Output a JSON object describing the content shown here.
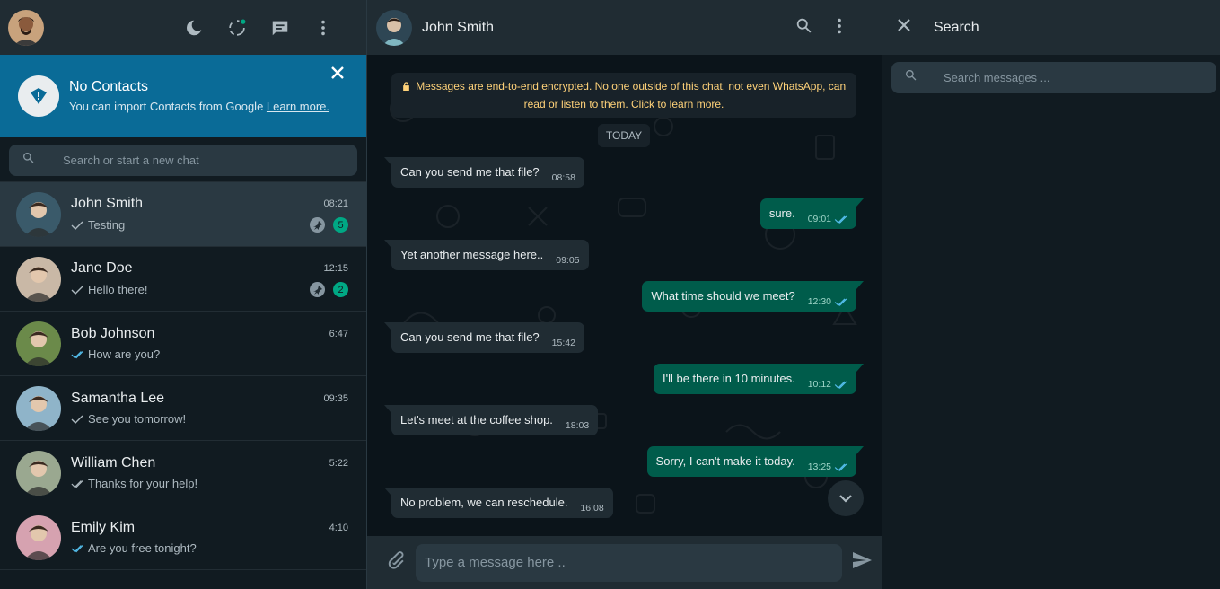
{
  "left": {
    "banner": {
      "title": "No Contacts",
      "subtitle": "You can import Contacts from Google",
      "link": "Learn more."
    },
    "search_placeholder": "Search or start a new chat",
    "chats": [
      {
        "name": "John Smith",
        "time": "08:21",
        "last": "Testing",
        "tick": "single",
        "pinned": true,
        "unread": "5",
        "active": true,
        "avatar_color": "#3a5a6a"
      },
      {
        "name": "Jane Doe",
        "time": "12:15",
        "last": "Hello there!",
        "tick": "single",
        "pinned": true,
        "unread": "2",
        "active": false,
        "avatar_color": "#c9b8a6"
      },
      {
        "name": "Bob Johnson",
        "time": "6:47",
        "last": "How are you?",
        "tick": "double-read",
        "pinned": false,
        "unread": "",
        "active": false,
        "avatar_color": "#6b8a4a"
      },
      {
        "name": "Samantha Lee",
        "time": "09:35",
        "last": "See you tomorrow!",
        "tick": "single",
        "pinned": false,
        "unread": "",
        "active": false,
        "avatar_color": "#8fb4c9"
      },
      {
        "name": "William Chen",
        "time": "5:22",
        "last": "Thanks for your help!",
        "tick": "double",
        "pinned": false,
        "unread": "",
        "active": false,
        "avatar_color": "#9aa890"
      },
      {
        "name": "Emily Kim",
        "time": "4:10",
        "last": "Are you free tonight?",
        "tick": "double-read",
        "pinned": false,
        "unread": "",
        "active": false,
        "avatar_color": "#d6a2b0"
      }
    ]
  },
  "chat": {
    "contact_name": "John Smith",
    "encryption_notice": "Messages are end-to-end encrypted. No one outside of this chat, not even WhatsApp, can read or listen to them. Click to learn more.",
    "day_label": "TODAY",
    "messages": [
      {
        "dir": "in",
        "text": "Can you send me that file?",
        "time": "08:58"
      },
      {
        "dir": "out",
        "text": "sure.",
        "time": "09:01"
      },
      {
        "dir": "in",
        "text": "Yet another message here..",
        "time": "09:05"
      },
      {
        "dir": "out",
        "text": "What time should we meet?",
        "time": "12:30"
      },
      {
        "dir": "in",
        "text": "Can you send me that file?",
        "time": "15:42"
      },
      {
        "dir": "out",
        "text": "I'll be there in 10 minutes.",
        "time": "10:12"
      },
      {
        "dir": "in",
        "text": "Let's meet at the coffee shop.",
        "time": "18:03"
      },
      {
        "dir": "out",
        "text": "Sorry, I can't make it today.",
        "time": "13:25"
      },
      {
        "dir": "in",
        "text": "No problem, we can reschedule.",
        "time": "16:08"
      }
    ],
    "composer_placeholder": "Type a message here .."
  },
  "search_panel": {
    "title": "Search",
    "placeholder": "Search messages ..."
  },
  "colors": {
    "accent": "#00a884",
    "banner": "#0a6b97",
    "outgoing_bubble": "#005c4b",
    "incoming_bubble": "#202c33",
    "read_tick": "#53bdeb"
  },
  "icons": [
    "moon-icon",
    "status-icon",
    "new-chat-icon",
    "menu-icon",
    "search-icon",
    "close-icon",
    "pin-icon",
    "attach-icon",
    "send-icon",
    "chevron-down-icon",
    "lock-icon",
    "alert-icon"
  ]
}
